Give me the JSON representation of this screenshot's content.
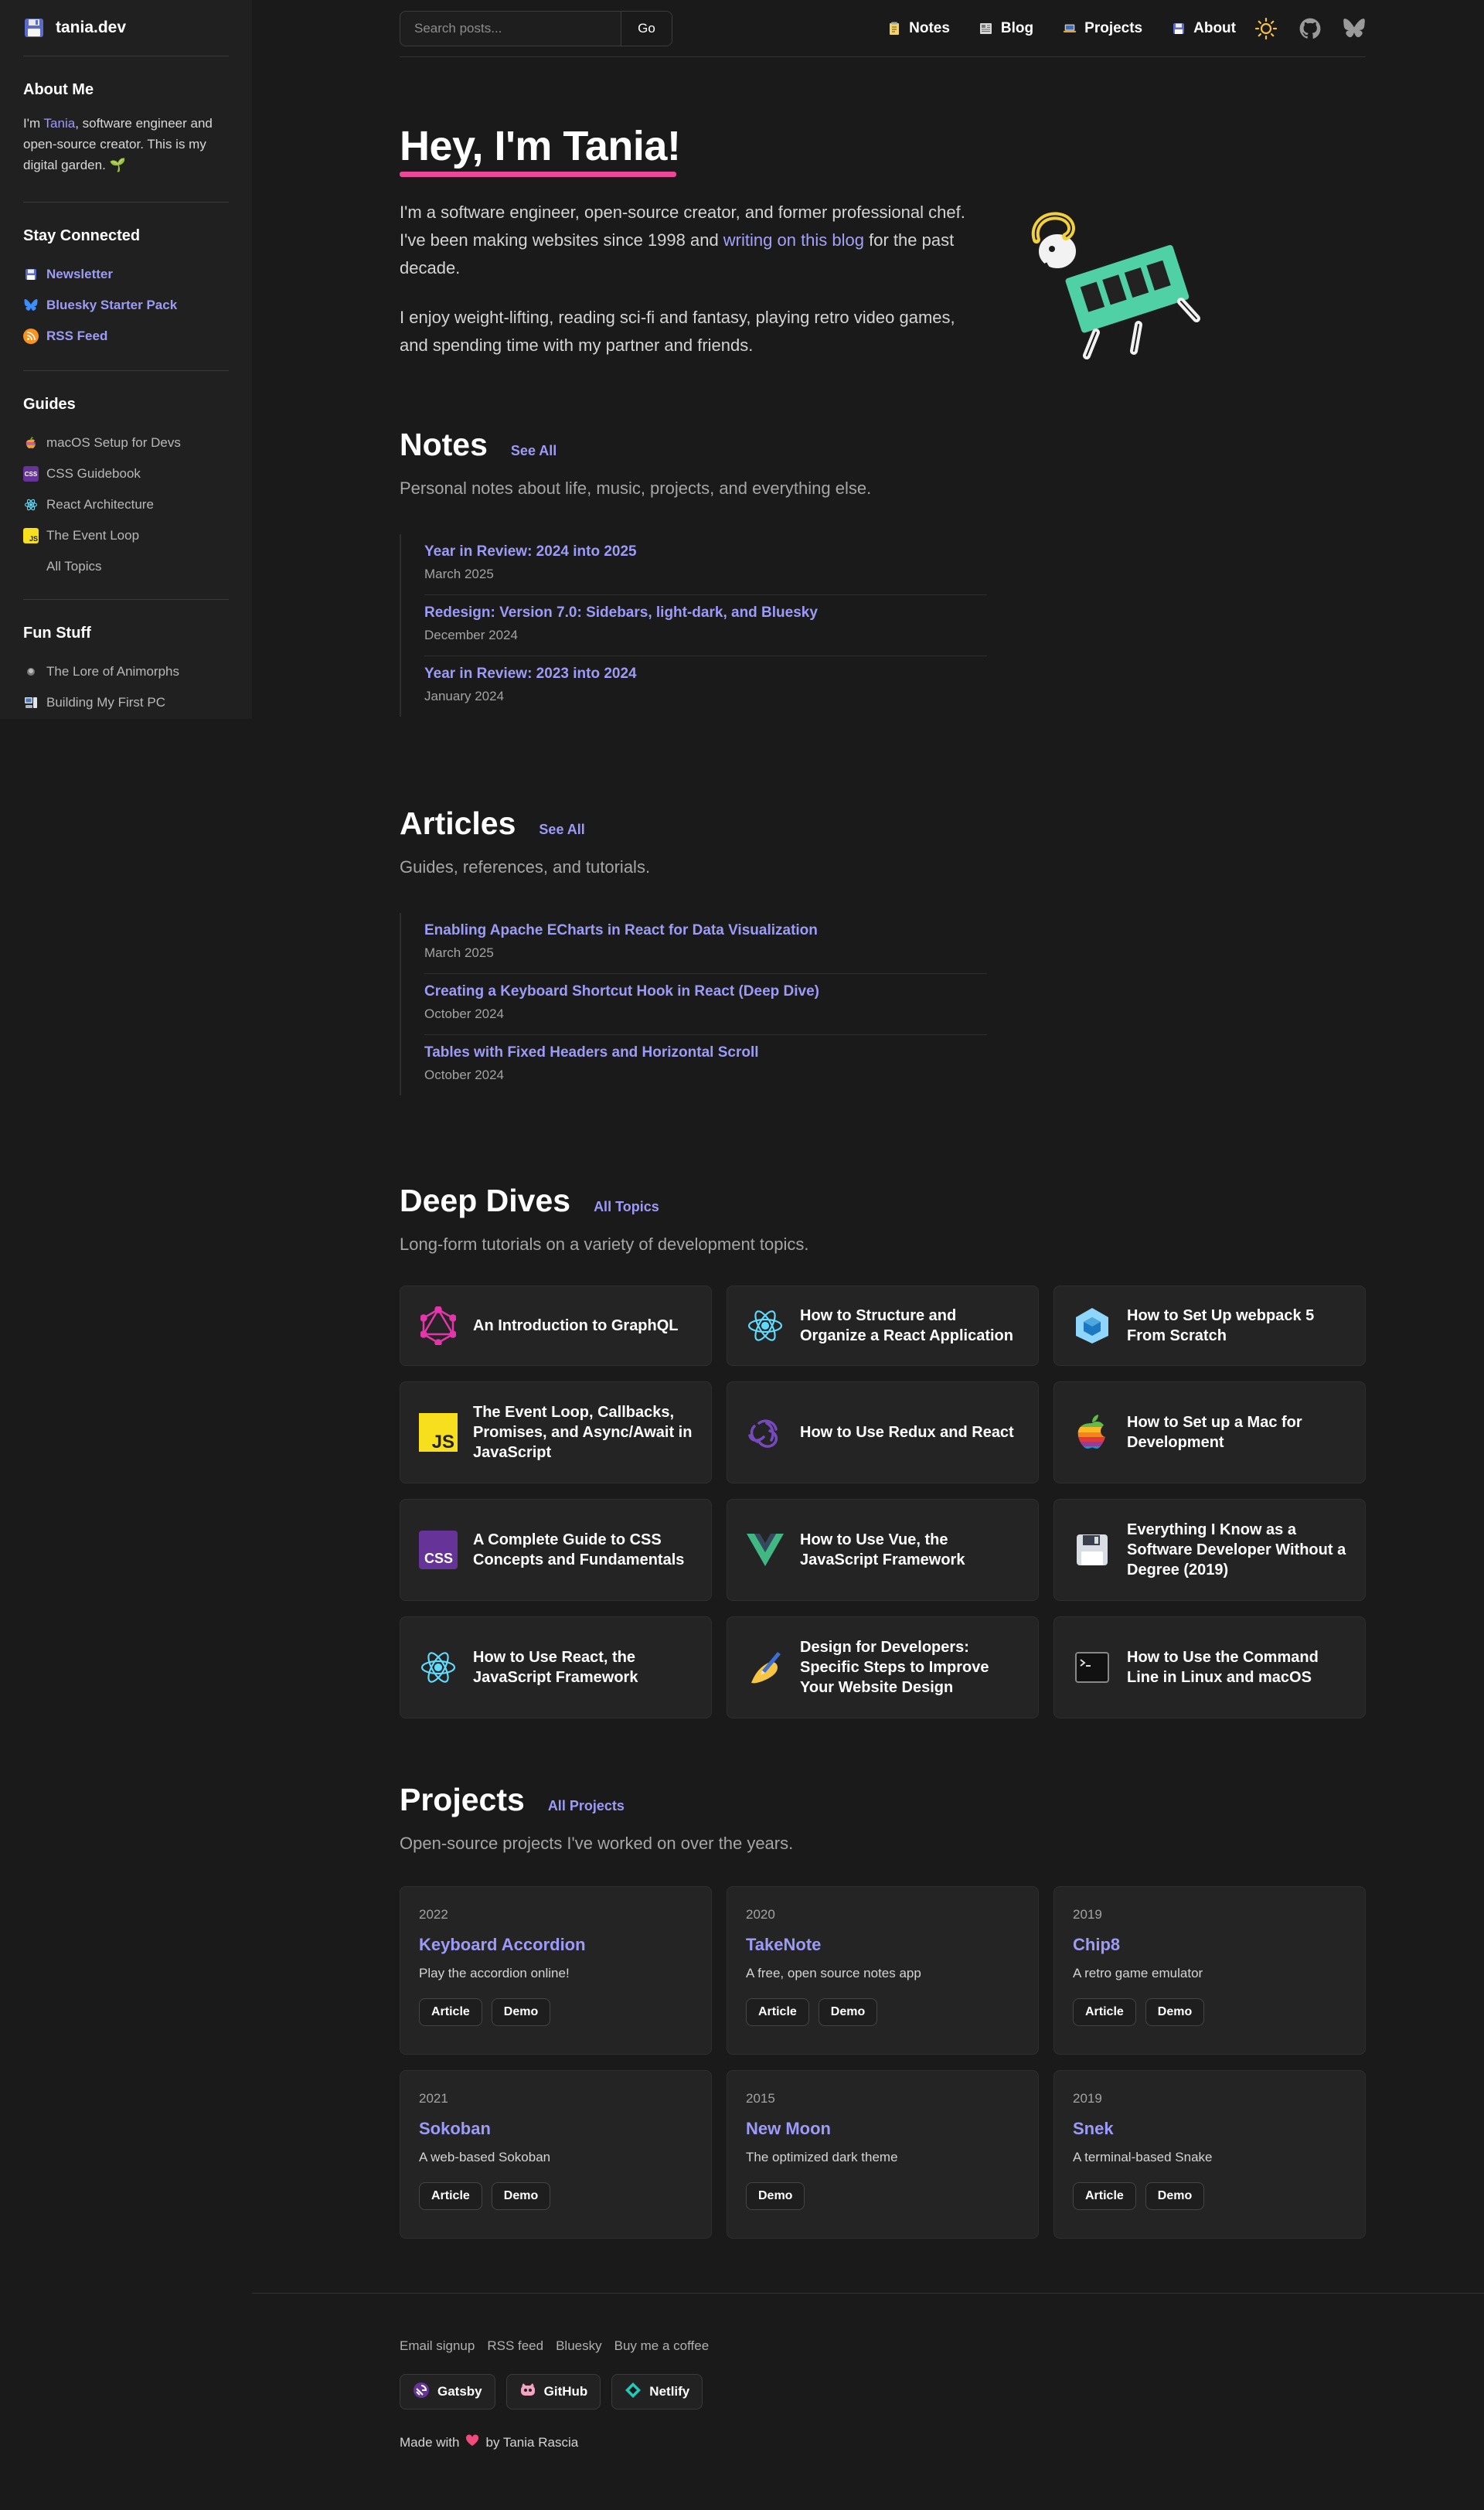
{
  "sidebar": {
    "brand": "tania.dev",
    "about": {
      "heading": "About Me",
      "intro_prefix": "I'm ",
      "name_link": "Tania",
      "intro_suffix": ", software engineer and open-source creator. This is my digital garden. 🌱"
    },
    "connected": {
      "heading": "Stay Connected",
      "items": [
        "Newsletter",
        "Bluesky Starter Pack",
        "RSS Feed"
      ]
    },
    "guides": {
      "heading": "Guides",
      "items": [
        "macOS Setup for Devs",
        "CSS Guidebook",
        "React Architecture",
        "The Event Loop",
        "All Topics"
      ]
    },
    "fun": {
      "heading": "Fun Stuff",
      "items": [
        "The Lore of Animorphs",
        "Building My First PC"
      ]
    }
  },
  "nav": {
    "search_placeholder": "Search posts...",
    "go_label": "Go",
    "links": [
      "Notes",
      "Blog",
      "Projects",
      "About"
    ],
    "icons": [
      "sun-icon",
      "github-icon",
      "bluesky-icon"
    ]
  },
  "hero": {
    "title": "Hey, I'm Tania!",
    "p1_before": "I'm a software engineer, open-source creator, and former professional chef. I've been making websites since 1998 and ",
    "p1_link": "writing on this blog",
    "p1_after": " for the past decade.",
    "p2": "I enjoy weight-lifting, reading sci-fi and fantasy, playing retro video games, and spending time with my partner and friends."
  },
  "notes": {
    "title": "Notes",
    "see_all": "See All",
    "subtitle": "Personal notes about life, music, projects, and everything else.",
    "items": [
      {
        "title": "Year in Review: 2024 into 2025",
        "date": "March 2025"
      },
      {
        "title": "Redesign: Version 7.0: Sidebars, light-dark, and Bluesky",
        "date": "December 2024"
      },
      {
        "title": "Year in Review: 2023 into 2024",
        "date": "January 2024"
      }
    ]
  },
  "articles": {
    "title": "Articles",
    "see_all": "See All",
    "subtitle": "Guides, references, and tutorials.",
    "items": [
      {
        "title": "Enabling Apache ECharts in React for Data Visualization",
        "date": "March 2025"
      },
      {
        "title": "Creating a Keyboard Shortcut Hook in React (Deep Dive)",
        "date": "October 2024"
      },
      {
        "title": "Tables with Fixed Headers and Horizontal Scroll",
        "date": "October 2024"
      }
    ]
  },
  "dives": {
    "title": "Deep Dives",
    "see_all": "All Topics",
    "subtitle": "Long-form tutorials on a variety of development topics.",
    "items": [
      {
        "title": "An Introduction to GraphQL",
        "icon": "graphql-icon"
      },
      {
        "title": "How to Structure and Organize a React Application",
        "icon": "react-icon"
      },
      {
        "title": "How to Set Up webpack 5 From Scratch",
        "icon": "webpack-icon"
      },
      {
        "title": "The Event Loop, Callbacks, Promises, and Async/Await in JavaScript",
        "icon": "javascript-icon"
      },
      {
        "title": "How to Use Redux and React",
        "icon": "redux-icon"
      },
      {
        "title": "How to Set up a Mac for Development",
        "icon": "apple-icon"
      },
      {
        "title": "A Complete Guide to CSS Concepts and Fundamentals",
        "icon": "css-icon"
      },
      {
        "title": "How to Use Vue, the JavaScript Framework",
        "icon": "vue-icon"
      },
      {
        "title": "Everything I Know as a Software Developer Without a Degree (2019)",
        "icon": "floppy-disk-icon"
      },
      {
        "title": "How to Use React, the JavaScript Framework",
        "icon": "react-icon"
      },
      {
        "title": "Design for Developers: Specific Steps to Improve Your Website Design",
        "icon": "writing-hand-icon"
      },
      {
        "title": "How to Use the Command Line in Linux and macOS",
        "icon": "terminal-icon"
      }
    ]
  },
  "projects": {
    "title": "Projects",
    "see_all": "All Projects",
    "subtitle": "Open-source projects I've worked on over the years.",
    "items": [
      {
        "year": "2022",
        "name": "Keyboard Accordion",
        "desc": "Play the accordion online!",
        "buttons": [
          "Article",
          "Demo"
        ]
      },
      {
        "year": "2020",
        "name": "TakeNote",
        "desc": "A free, open source notes app",
        "buttons": [
          "Article",
          "Demo"
        ]
      },
      {
        "year": "2019",
        "name": "Chip8",
        "desc": "A retro game emulator",
        "buttons": [
          "Article",
          "Demo"
        ]
      },
      {
        "year": "2021",
        "name": "Sokoban",
        "desc": "A web-based Sokoban",
        "buttons": [
          "Article",
          "Demo"
        ]
      },
      {
        "year": "2015",
        "name": "New Moon",
        "desc": "The optimized dark theme",
        "buttons": [
          "Demo"
        ]
      },
      {
        "year": "2019",
        "name": "Snek",
        "desc": "A terminal-based Snake",
        "buttons": [
          "Article",
          "Demo"
        ]
      }
    ]
  },
  "footer": {
    "links": [
      "Email signup",
      "RSS feed",
      "Bluesky",
      "Buy me a coffee"
    ],
    "badges": [
      "Gatsby",
      "GitHub",
      "Netlify"
    ],
    "made_prefix": "Made with",
    "made_suffix": "by Tania Rascia"
  },
  "colors": {
    "background": "#1a1a1a",
    "sidebar": "#202020",
    "accent": "#9d9bf8",
    "underline": "#ec4899",
    "card": "#242424"
  }
}
